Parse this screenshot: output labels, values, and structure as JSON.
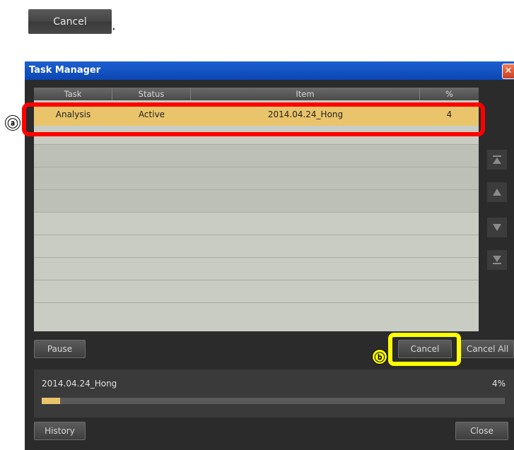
{
  "top_button": {
    "label": "Cancel",
    "suffix": "."
  },
  "window": {
    "title": "Task Manager",
    "close_glyph": "✕",
    "table": {
      "headers": [
        "Task",
        "Status",
        "Item",
        "%"
      ],
      "rows": [
        {
          "task": "Analysis",
          "status": "Active",
          "item": "2014.04.24_Hong",
          "percent": "4"
        }
      ]
    },
    "scroll_buttons": [
      "scroll-top-icon",
      "scroll-up-icon",
      "scroll-down-icon",
      "scroll-bottom-icon"
    ],
    "buttons": {
      "pause": "Pause",
      "cancel": "Cancel",
      "cancel_all": "Cancel All",
      "history": "History",
      "close": "Close"
    },
    "progress": {
      "name": "2014.04.24_Hong",
      "percent_text": "4%",
      "fraction": 0.04
    }
  },
  "annotations": {
    "a": "ⓐ",
    "b": "ⓑ"
  },
  "colors": {
    "selected_row": "#e9c46a",
    "annotation_red": "#ff0000",
    "annotation_yellow": "#ffff00",
    "titlebar": "#0b47b4"
  }
}
